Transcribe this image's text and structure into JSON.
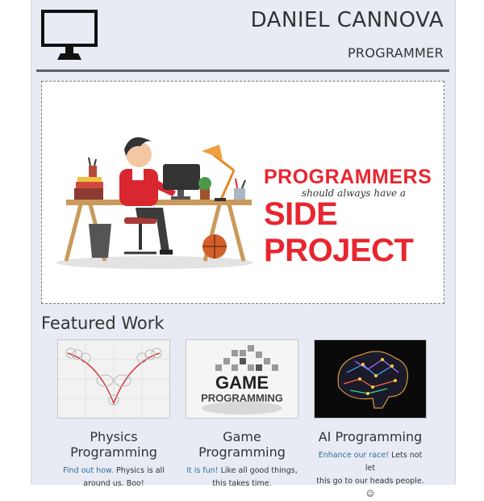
{
  "header": {
    "name": "DANIEL CANNOVA",
    "role": "PROGRAMMER",
    "logo_icon": "monitor-icon"
  },
  "hero": {
    "line1": "PROGRAMMERS",
    "line2": "should always have a",
    "line3": "SIDE PROJECT"
  },
  "featured": {
    "heading": "Featured Work",
    "cards": [
      {
        "title_line1": "Physics",
        "title_line2": "Programming",
        "link": "Find out how.",
        "text_line1": " Physics is all",
        "text_line2": "around us. Boo!"
      },
      {
        "title_line1": "Game",
        "title_line2": "Programming",
        "thumb_text_1": "GAME",
        "thumb_text_2": "PROGRAMMING",
        "link": "It is fun!",
        "text_line1": " Like all good things,",
        "text_line2": "this takes time."
      },
      {
        "title_line1": "AI Programming",
        "link": "Enhance our race!",
        "text_line1": " Lets not let",
        "text_line2": "this go to our heads people. ☺"
      }
    ]
  },
  "colors": {
    "accent_red": "#e8262f",
    "link_blue": "#2f6ea0",
    "page_bg": "#e8ebf4"
  }
}
